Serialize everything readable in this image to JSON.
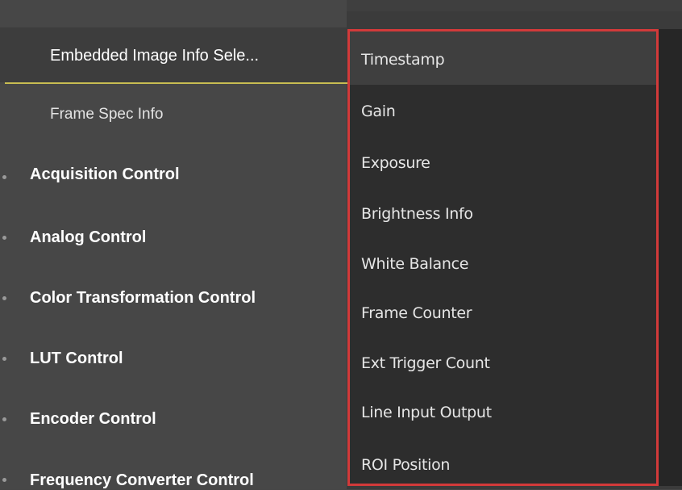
{
  "tree": {
    "selected_item": "Embedded Image Info Sele...",
    "frame_spec": "Frame Spec Info",
    "categories": [
      "Acquisition Control",
      "Analog Control",
      "Color Transformation Control",
      "LUT Control",
      "Encoder Control",
      "Frequency Converter Control"
    ]
  },
  "dropdown": {
    "options": [
      "Timestamp",
      "Gain",
      "Exposure",
      "Brightness Info",
      "White Balance",
      "Frame Counter",
      "Ext Trigger Count",
      "Line Input Output",
      "ROI Position"
    ],
    "selected_index": 0
  },
  "colors": {
    "highlight_border": "#d23a3a",
    "selection_underline": "#c8bd52"
  }
}
